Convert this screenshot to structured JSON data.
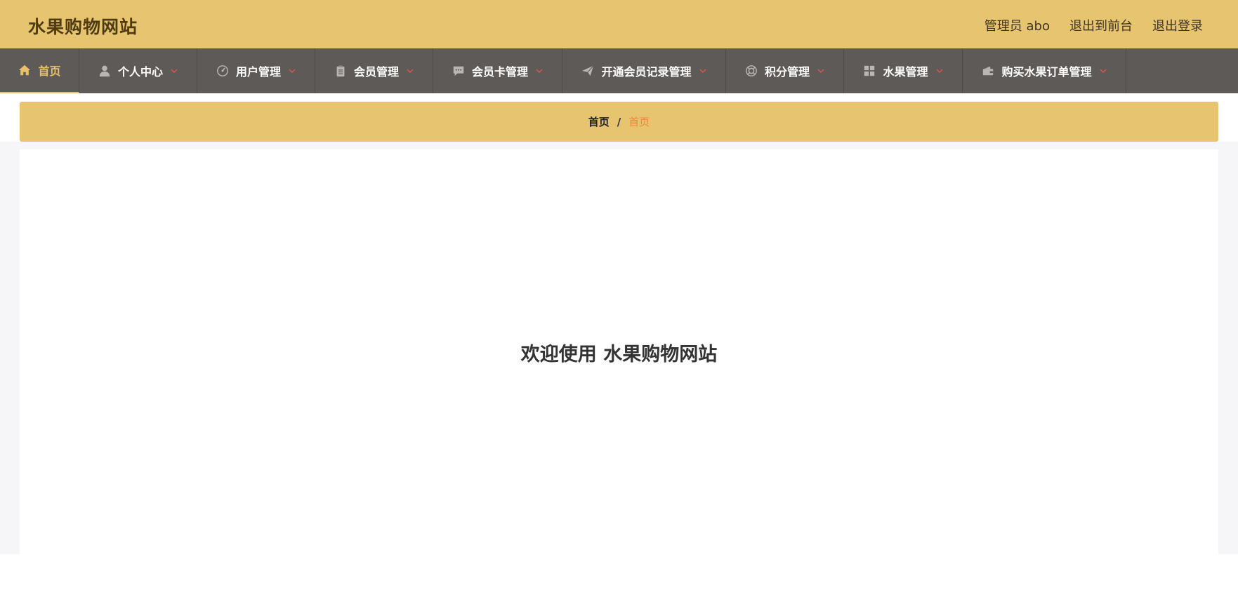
{
  "header": {
    "site_title": "水果购物网站",
    "admin_label": "管理员 abo",
    "frontend_link": "退出到前台",
    "logout_link": "退出登录"
  },
  "nav": {
    "items": [
      {
        "label": "首页",
        "icon": "home-icon"
      },
      {
        "label": "个人中心",
        "icon": "user-icon"
      },
      {
        "label": "用户管理",
        "icon": "dashboard-icon"
      },
      {
        "label": "会员管理",
        "icon": "clipboard-icon"
      },
      {
        "label": "会员卡管理",
        "icon": "comment-icon"
      },
      {
        "label": "开通会员记录管理",
        "icon": "send-icon"
      },
      {
        "label": "积分管理",
        "icon": "lifebuoy-icon"
      },
      {
        "label": "水果管理",
        "icon": "grid-icon"
      },
      {
        "label": "购买水果订单管理",
        "icon": "wallet-icon"
      }
    ]
  },
  "breadcrumb": {
    "home": "首页",
    "separator": "/",
    "current": "首页"
  },
  "main": {
    "welcome": "欢迎使用 水果购物网站"
  },
  "colors": {
    "header_bg": "#e7c570",
    "nav_bg": "#5e5a57",
    "active_nav": "#e8c06a",
    "chevron": "#e0524b",
    "breadcrumb_current": "#f0843c"
  }
}
